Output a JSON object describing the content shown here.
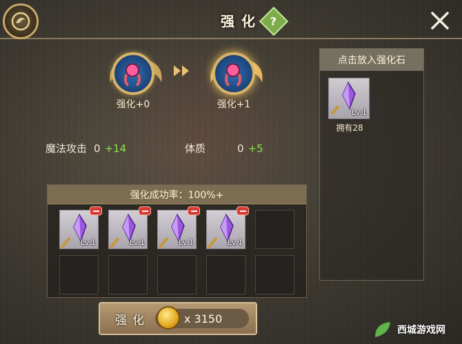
{
  "header": {
    "title": "强化",
    "help_label": "?"
  },
  "enhance": {
    "current_label": "强化+0",
    "next_label": "强化+1"
  },
  "stats": [
    {
      "name": "魔法攻击",
      "value": "0",
      "bonus": "+14"
    },
    {
      "name": "体质",
      "value": "0",
      "bonus": "+5"
    }
  ],
  "stones_panel": {
    "header": "点击放入强化石",
    "items": [
      {
        "level": "Lv.1",
        "owned": "拥有28"
      }
    ]
  },
  "slots_panel": {
    "success_rate": "强化成功率：100%+",
    "filled": [
      {
        "level": "Lv.1"
      },
      {
        "level": "Lv.1"
      },
      {
        "level": "Lv.1"
      },
      {
        "level": "Lv.1"
      }
    ]
  },
  "action": {
    "label": "强化",
    "cost": "x 3150"
  },
  "watermark": "西城游戏网",
  "colors": {
    "bonus_green": "#8fe04a",
    "gold": "#d7b36a",
    "remove_red": "#d83a34"
  }
}
